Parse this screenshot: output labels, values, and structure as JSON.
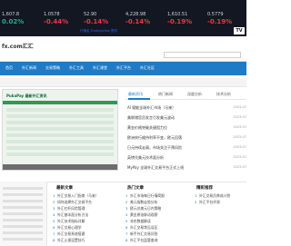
{
  "ticker": {
    "items": [
      {
        "price": "1,607.8",
        "change": "0.02%"
      },
      {
        "price": "1.0578",
        "change": "-0.44%"
      },
      {
        "price": "52.90",
        "change": "-0.14%"
      },
      {
        "price": "4,228.98",
        "change": "-0.14%"
      },
      {
        "price": "1,610.51",
        "change": "-0.19%"
      },
      {
        "price": "0.5779",
        "change": "-0.19%"
      }
    ],
    "credit": "行情由 TradingView 提供"
  },
  "site": {
    "logo": "fx.com汇汇"
  },
  "nav": {
    "items": [
      "首页",
      "外汇新闻",
      "交易策略",
      "外汇工具",
      "外汇课堂",
      "外汇平台",
      "外汇社区"
    ]
  },
  "hero": {
    "title": "PukaPay 最新外汇资讯"
  },
  "tabs": {
    "items": [
      "最新资讯",
      "热门新闻",
      "深度分析",
      "技术分析"
    ],
    "active": 0
  },
  "news": [
    {
      "title": "AI 赋能全球外汇市场（马来）",
      "time": "2023-07"
    },
    {
      "title": "美联储官员发言引发美元波动",
      "time": "2023-07"
    },
    {
      "title": "黄金价格突破关键阻力位",
      "time": "2023-07"
    },
    {
      "title": "欧洲央行维持利率不变，欧元回落",
      "time": "2023-07"
    },
    {
      "title": "日元持续走弱，市场关注干预风险",
      "time": "2023-07"
    },
    {
      "title": "英镑兑美元技术面分析",
      "time": "2023-07"
    },
    {
      "title": "MyPay 全球外汇交易平台正式上线",
      "time": "2023-07"
    }
  ],
  "bottom": {
    "columns": [
      {
        "title": "最新文章",
        "items": [
          "外汇交易入门指南（马来）",
          "如何选择外汇交易平台",
          "外汇杠杆风险管理",
          "外汇基本面分析方法",
          "外汇技术指标详解",
          "外汇交易心理学",
          "外汇交易系统搭建",
          "外汇止损设置技巧"
        ]
      },
      {
        "title": "热门文章",
        "items": [
          "外汇市场每日行情简报",
          "美元指数走势分析",
          "欧元兑美元日内策略",
          "黄金原油联动观察",
          "非农数据解读",
          "外汇交易常见误区",
          "新手外汇交易问答",
          "外汇平台监管查询"
        ]
      },
      {
        "title": "精彩推荐",
        "items": [
          "外汇交易员养成计划",
          "外汇平台评测"
        ]
      }
    ]
  }
}
